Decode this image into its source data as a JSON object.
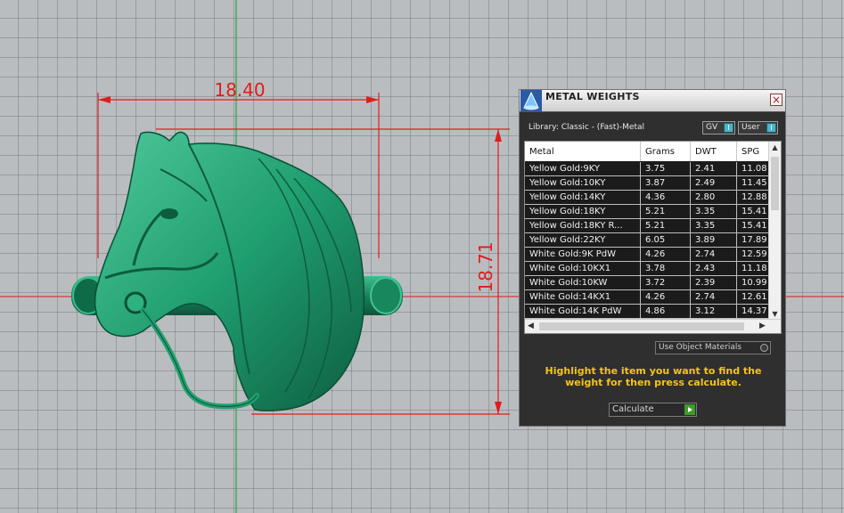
{
  "viewport": {
    "dimensions": [
      "18.40",
      "18.71"
    ]
  },
  "panel": {
    "title": "METAL WEIGHTS",
    "close_label": "×",
    "library": "Library: Classic - (Fast)-Metal",
    "gv_label": "GV",
    "user_label": "User",
    "toggle_glyph": "I",
    "columns": [
      "Metal",
      "Grams",
      "DWT",
      "SPG"
    ],
    "rows": [
      [
        "Yellow Gold:9KY",
        "3.75",
        "2.41",
        "11.08"
      ],
      [
        "Yellow Gold:10KY",
        "3.87",
        "2.49",
        "11.45"
      ],
      [
        "Yellow Gold:14KY",
        "4.36",
        "2.80",
        "12.88"
      ],
      [
        "Yellow Gold:18KY",
        "5.21",
        "3.35",
        "15.41"
      ],
      [
        "Yellow Gold:18KY R...",
        "5.21",
        "3.35",
        "15.41"
      ],
      [
        "Yellow Gold:22KY",
        "6.05",
        "3.89",
        "17.89"
      ],
      [
        "White Gold:9K PdW",
        "4.26",
        "2.74",
        "12.59"
      ],
      [
        "White Gold:10KX1",
        "3.78",
        "2.43",
        "11.18"
      ],
      [
        "White Gold:10KW",
        "3.72",
        "2.39",
        "10.99"
      ],
      [
        "White Gold:14KX1",
        "4.26",
        "2.74",
        "12.61"
      ],
      [
        "White Gold:14K PdW",
        "4.86",
        "3.12",
        "14.37"
      ]
    ],
    "scroll_up": "▲",
    "scroll_down": "▼",
    "scroll_left": "◀",
    "scroll_right": "▶",
    "use_materials": "Use Object Materials",
    "hint": "Highlight the item you want to find the weight for then press calculate.",
    "calculate": "Calculate"
  }
}
